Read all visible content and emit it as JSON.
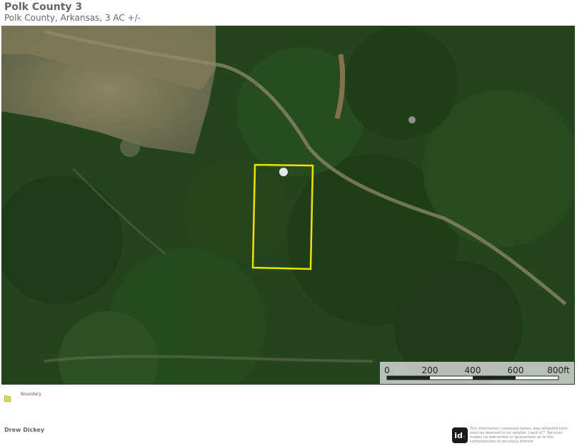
{
  "header": {
    "title": "Polk County 3",
    "subtitle": "Polk County, Arkansas, 3 AC +/-"
  },
  "map": {
    "imagery": "satellite-forest",
    "boundary_color": "#f0e000",
    "scalebar": {
      "labels": [
        "0",
        "200",
        "400",
        "600",
        "800ft"
      ]
    }
  },
  "legend": {
    "items": [
      {
        "label": "Boundary",
        "icon": "boundary-polygon-icon",
        "color": "#d8d860"
      }
    ]
  },
  "footer": {
    "agent": "Drew Dickey",
    "logo_text": "id",
    "disclaimer": "The information contained herein was obtained from sources deemed to be reliable. Land id™ Services makes no warranties or guarantees as to the completeness or accuracy thereof."
  }
}
